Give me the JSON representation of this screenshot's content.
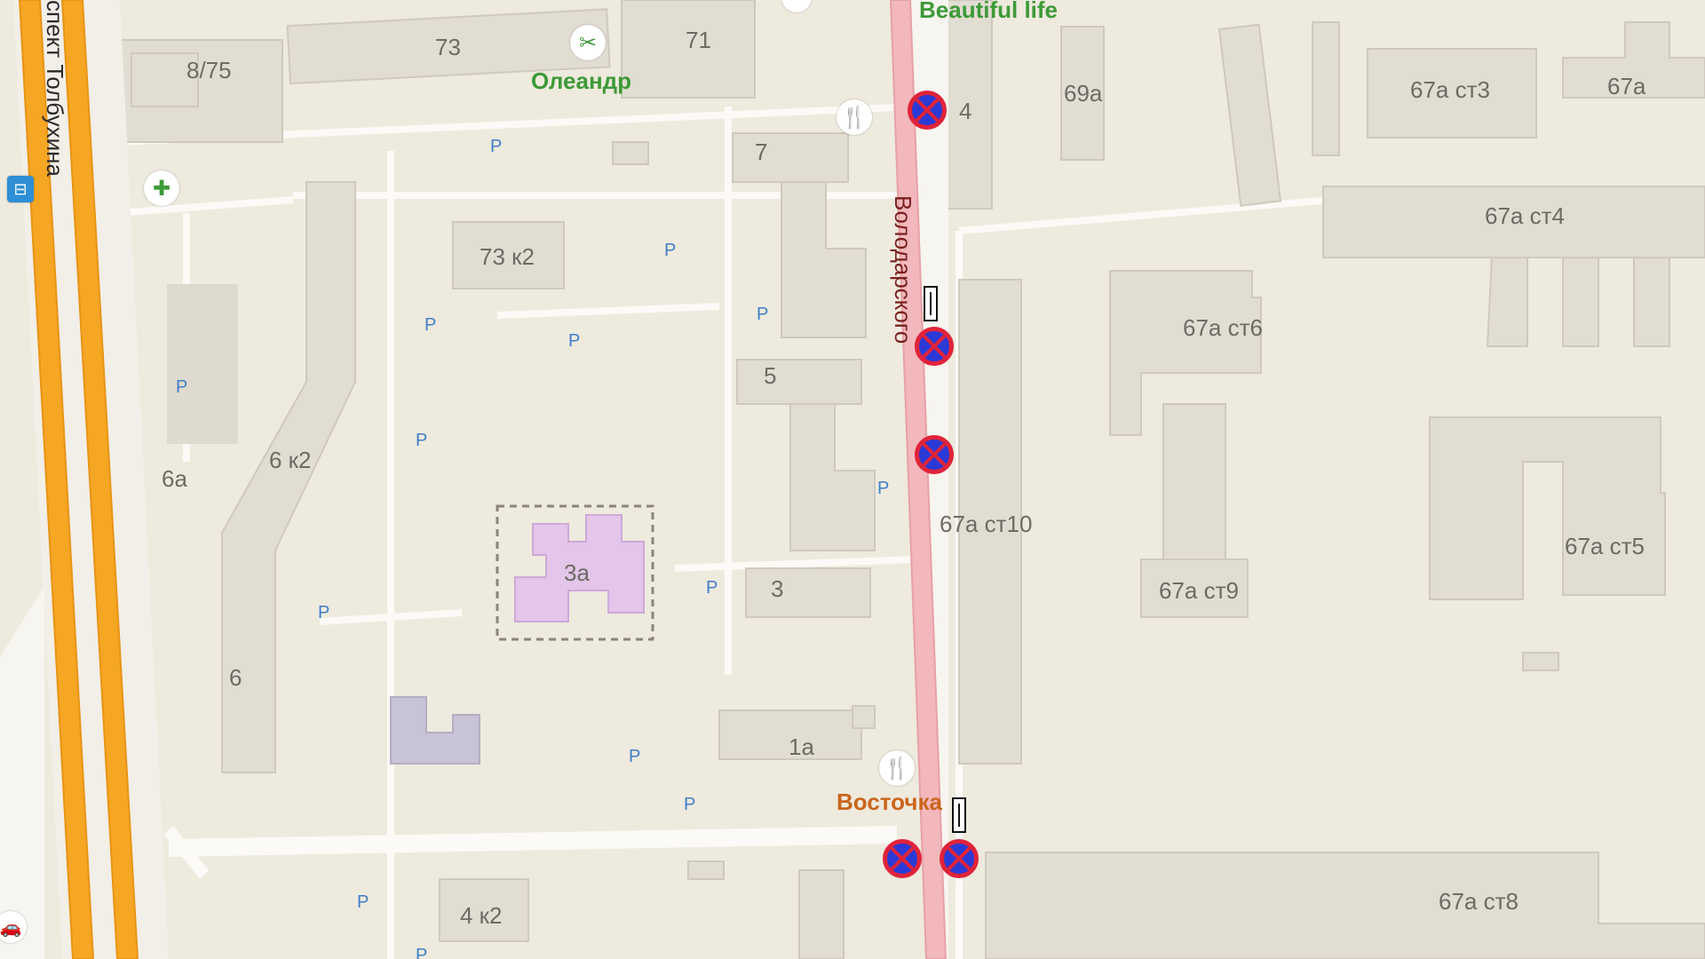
{
  "map": {
    "streets": {
      "main_street": "Володарского",
      "avenue": "спект Толбухина"
    },
    "pois": {
      "poi_1": "Beautiful life",
      "poi_2": "Олеандр",
      "poi_3": "Восточка"
    },
    "house_numbers": {
      "n1": "73",
      "n2": "8/75",
      "n3": "71",
      "n4": "4",
      "n5": "69а",
      "n6": "67а ст3",
      "n7": "67а",
      "n8": "7",
      "n9": "67а ст4",
      "n10": "73 к2",
      "n11": "67а ст6",
      "n12": "5",
      "n13": "6 к2",
      "n14": "6а",
      "n15": "67а ст10",
      "n16": "3а",
      "n17": "3",
      "n18": "67а ст9",
      "n19": "67а ст5",
      "n20": "6",
      "n21": "1а",
      "n22": "4 к2",
      "n23": "67а ст8"
    },
    "parking_label": "P",
    "colors": {
      "background": "#eeeade",
      "building": "#e2ddd2",
      "avenue": "#f5a623",
      "street_highlight": "#f2b8bc",
      "no_parking_blue": "#2b3ad6",
      "no_parking_red": "#e0233a",
      "parking_text": "#3f7ec8",
      "kindergarten": "#e3c6ea"
    },
    "icons": [
      "no-parking-sign-icon",
      "sign-plate-icon",
      "restaurant-icon",
      "pharmacy-icon",
      "scissors-icon",
      "bus-stop-icon",
      "car-icon"
    ]
  }
}
